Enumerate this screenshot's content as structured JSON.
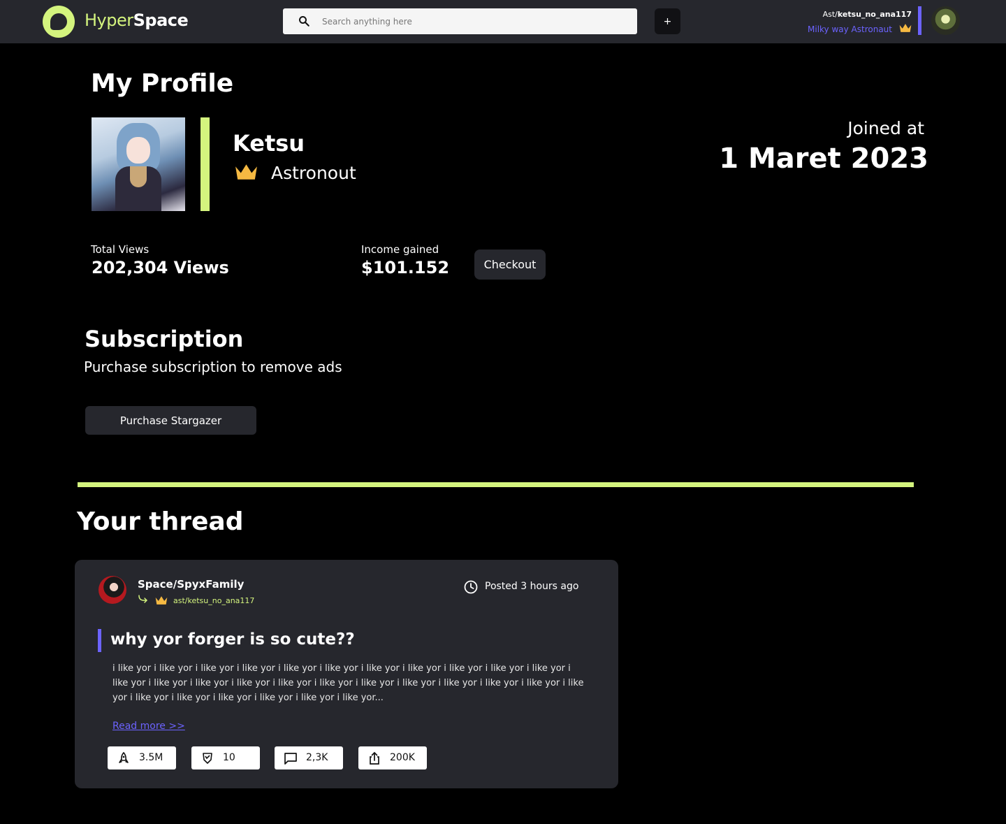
{
  "header": {
    "brand_part1": "Hyper",
    "brand_part2": "Space",
    "search_placeholder": "Search anything here",
    "add_label": "+",
    "user_prefix": "Ast/",
    "user_handle": "ketsu_no_ana117",
    "user_rank": "Milky way Astronaut"
  },
  "profile": {
    "heading": "My Profile",
    "name": "Ketsu",
    "rank": "Astronout",
    "joined_label": "Joined at",
    "joined_date": "1 Maret 2023",
    "views_label": "Total Views",
    "views_value": "202,304 Views",
    "income_label": "Income gained",
    "income_value": "$101.152",
    "checkout_label": "Checkout"
  },
  "subscription": {
    "title": "Subscription",
    "description": "Purchase subscription to remove ads",
    "button_label": "Purchase Stargazer"
  },
  "thread": {
    "heading": "Your thread",
    "space": "Space/SpyxFamily",
    "author": "ast/ketsu_no_ana117",
    "posted": "Posted 3 hours ago",
    "title": "why yor forger is so cute??",
    "body": "i like yor i like yor i like yor i like yor i like yor i like yor i like yor i like yor i like yor i like yor i like yor i like yor i like yor i like yor i like yor i like yor i like yor i like yor i like yor i like yor i like yor i like yor i like yor i like yor i like yor i like yor i like yor i like yor i like yor...",
    "read_more": "Read more >>",
    "stats": {
      "boosts": "3.5M",
      "awards": "10",
      "comments": "2,3K",
      "shares": "200K"
    }
  },
  "colors": {
    "accent_lime": "#d4f47e",
    "accent_purple": "#6c63ff",
    "crown": "#f5b942",
    "panel": "#26272d"
  },
  "icons": {
    "search": "search-icon",
    "crown": "crown-icon",
    "clock": "clock-icon",
    "rocket": "rocket-icon",
    "badge": "badge-icon",
    "comment": "comment-icon",
    "share": "share-icon"
  }
}
